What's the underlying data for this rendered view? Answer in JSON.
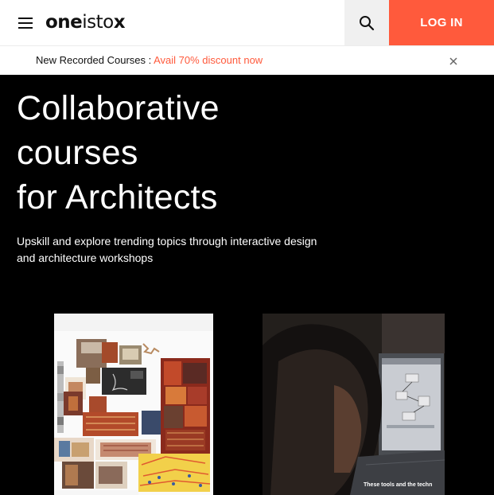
{
  "header": {
    "logo_left": "one",
    "logo_mid": "isto",
    "logo_right": "x",
    "search_icon": "search-icon",
    "menu_icon": "hamburger-menu-icon",
    "login_label": "LOG IN",
    "login_color": "#ff5a3c"
  },
  "announcement": {
    "label": "New Recorded Courses : ",
    "link": "Avail 70% discount now",
    "close_icon": "close-icon"
  },
  "hero": {
    "title_line1": "Collaborative",
    "title_line2": "courses",
    "title_line3": "for Architects",
    "subtitle_line1": "Upskill and explore trending topics through interactive design",
    "subtitle_line2": "and architecture workshops"
  },
  "cards": [
    {
      "kind": "collage-image"
    },
    {
      "kind": "video-thumbnail",
      "caption": "These tools and the techn"
    }
  ]
}
